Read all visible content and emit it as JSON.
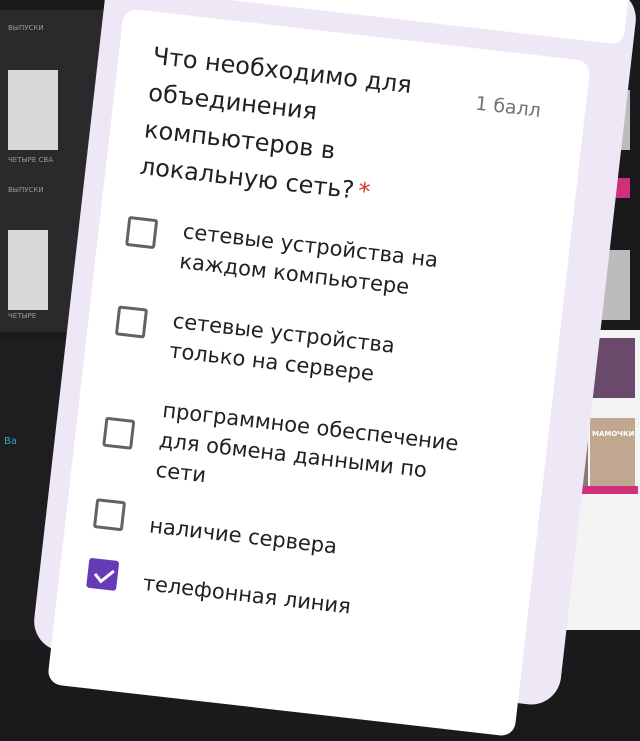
{
  "background": {
    "labels": [
      "ВЫПУСКИ",
      "ЧЕТЫРЕ СВА",
      "ВЫПУСКИ",
      "ЧЕТЫРЕ",
      "МАМОЧКИ",
      "Ва"
    ]
  },
  "question": {
    "title": "Что необходимо для объединения компьютеров в локальную сеть?",
    "required_mark": "*",
    "points": "1 балл",
    "options": [
      {
        "label": "сетевые устройства на каждом компьютере",
        "checked": false
      },
      {
        "label": "сетевые устройства только на сервере",
        "checked": false
      },
      {
        "label": "программное обеспечение для обмена данными по сети",
        "checked": false
      },
      {
        "label": "наличие сервера",
        "checked": false
      },
      {
        "label": "телефонная линия",
        "checked": true
      }
    ]
  },
  "colors": {
    "accent": "#673ab7",
    "required": "#d93025",
    "form_background": "#ede7f6"
  }
}
